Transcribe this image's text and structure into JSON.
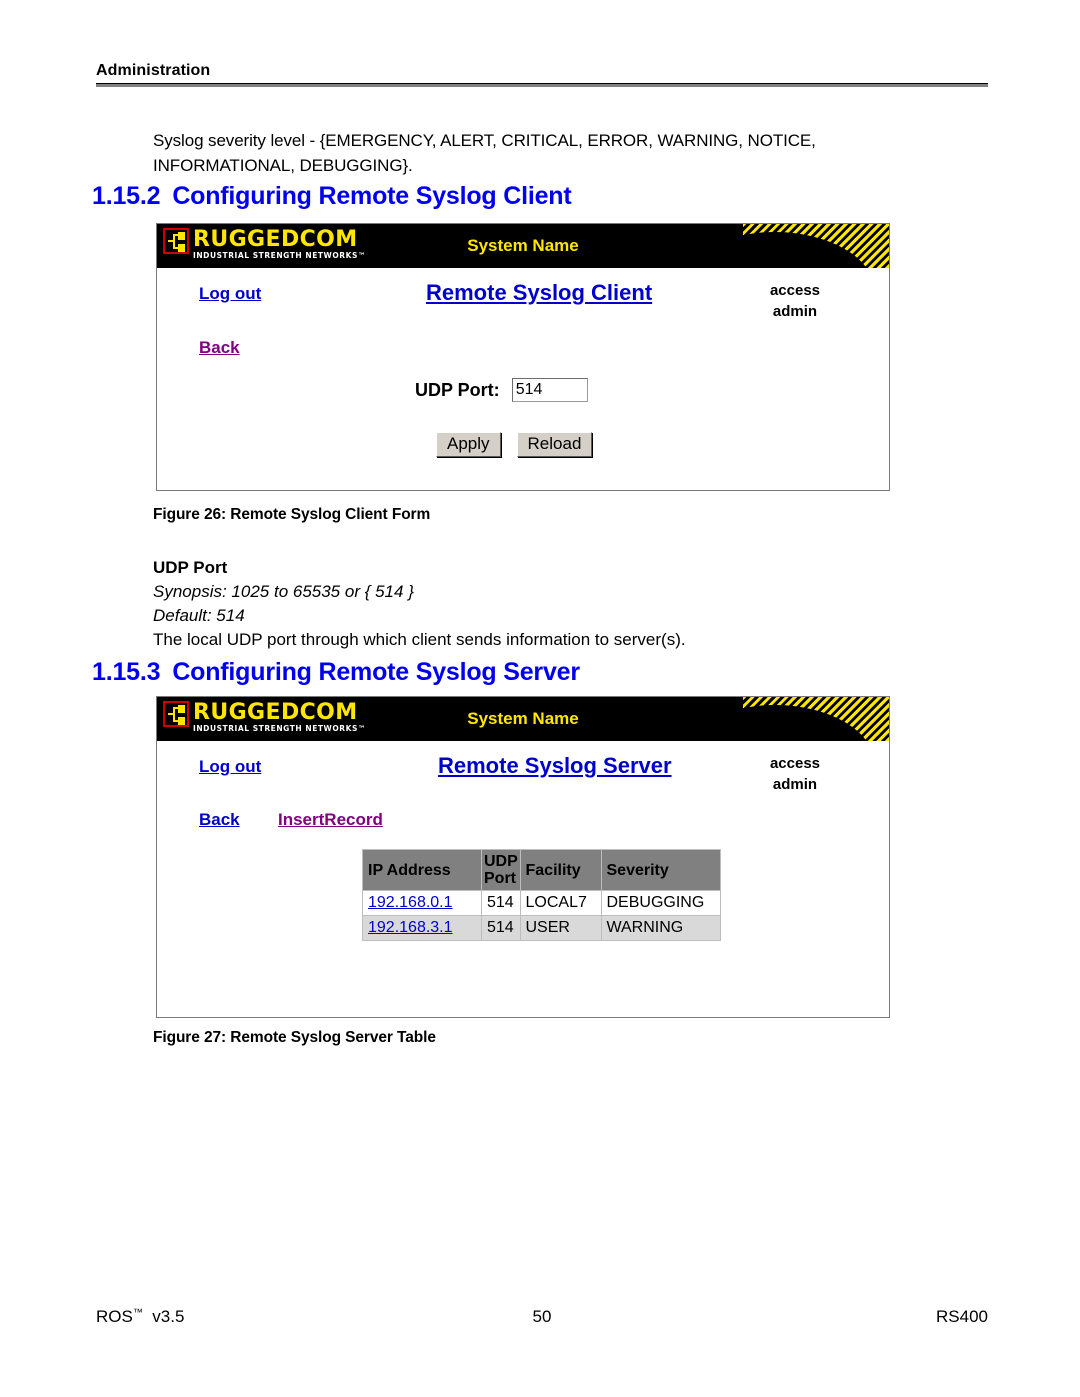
{
  "page": {
    "running_head": "Administration",
    "intro_paragraph_line1": "Syslog severity level - {EMERGENCY, ALERT, CRITICAL, ERROR, WARNING, NOTICE,",
    "intro_paragraph_line2": "INFORMATIONAL, DEBUGGING}."
  },
  "section_client": {
    "number": "1.15.2",
    "title": "Configuring Remote Syslog Client",
    "figure_caption": "Figure 26: Remote Syslog Client Form"
  },
  "section_server": {
    "number": "1.15.3",
    "title": "Configuring Remote Syslog Server",
    "figure_caption": "Figure 27: Remote Syslog Server Table"
  },
  "parameter_udp_port": {
    "term": "UDP Port",
    "synopsis": "Synopsis: 1025 to 65535 or { 514 }",
    "default": "Default: 514",
    "description": "The local UDP port through which client sends information to server(s)."
  },
  "screenshot_client": {
    "brand_main": "RUGGEDCOM",
    "brand_sub": "INDUSTRIAL STRENGTH NETWORKS™",
    "system_name": "System Name",
    "logout_link": "Log out",
    "back_link": "Back",
    "page_title": "Remote Syslog Client",
    "access_label": "access",
    "access_user": "admin",
    "udp_port_label": "UDP Port:",
    "udp_port_value": "514",
    "apply_button": "Apply",
    "reload_button": "Reload"
  },
  "screenshot_server": {
    "brand_main": "RUGGEDCOM",
    "brand_sub": "INDUSTRIAL STRENGTH NETWORKS™",
    "system_name": "System Name",
    "logout_link": "Log out",
    "back_link": "Back",
    "insert_record_link": "InsertRecord",
    "page_title": "Remote Syslog Server",
    "access_label": "access",
    "access_user": "admin",
    "table": {
      "columns": [
        "IP Address",
        "UDP Port",
        "Facility",
        "Severity"
      ],
      "rows": [
        {
          "ip": "192.168.0.1",
          "udp_port": "514",
          "facility": "LOCAL7",
          "severity": "DEBUGGING"
        },
        {
          "ip": "192.168.3.1",
          "udp_port": "514",
          "facility": "USER",
          "severity": "WARNING"
        }
      ]
    }
  },
  "footer": {
    "product": "ROS",
    "trademark": "™",
    "version": "v3.5",
    "page_number": "50",
    "model": "RS400"
  },
  "colors": {
    "heading_blue": "#0000ee",
    "link_blue": "#0000cc",
    "link_purple": "#800080",
    "brand_yellow": "#ffe600",
    "header_black": "#000000",
    "table_header_gray": "#808080",
    "table_row_alt_gray": "#d9d9d9"
  }
}
